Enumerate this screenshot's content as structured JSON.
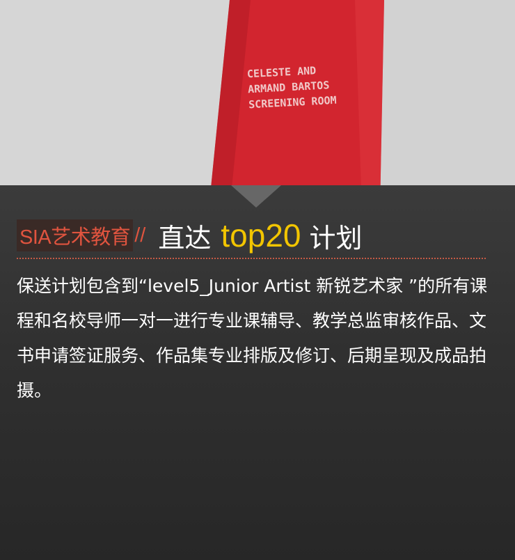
{
  "photo": {
    "sign_lines": [
      "CELESTE AND",
      "ARMAND BARTOS",
      "SCREENING ROOM"
    ]
  },
  "heading": {
    "brand": "SIA艺术教育",
    "slash": "//",
    "word1": "直达",
    "word2": "top20",
    "word3": "计划"
  },
  "body_text": "保送计划包含到“level5_Junior Artist 新锐艺术家 ”的所有课程和名校导师一对一进行专业课辅导、教学总监审核作品、文书申请签证服务、作品集专业排版及修订、后期呈现及成品拍摄。",
  "colors": {
    "brand": "#e0543f",
    "highlight": "#f2c500",
    "panel": "#303030",
    "sign": "#d2252f"
  }
}
